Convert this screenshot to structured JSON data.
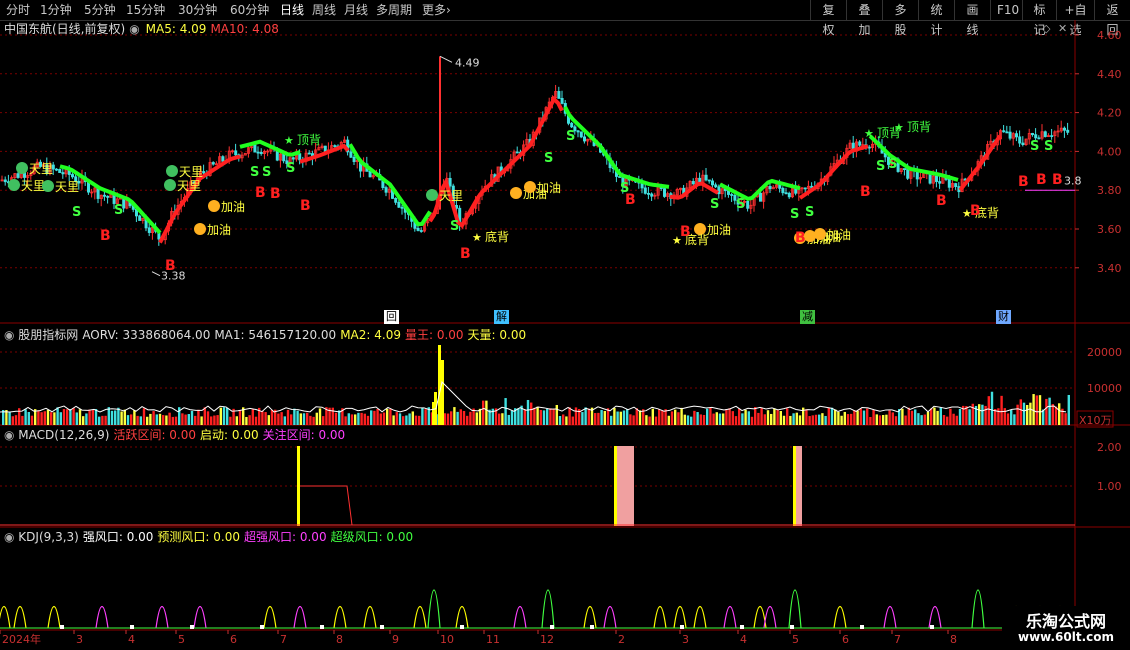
{
  "toolbar": {
    "periods": [
      "分时",
      "1分钟",
      "5分钟",
      "15分钟",
      "30分钟",
      "60分钟",
      "日线",
      "周线",
      "月线",
      "多周期",
      "更多"
    ],
    "active_period": "日线",
    "more_arrow": "›",
    "right_buttons": [
      "复权",
      "叠加",
      "多股",
      "统计",
      "画线",
      "F10",
      "标记",
      "+自选",
      "返回"
    ]
  },
  "main_panel": {
    "stock_name": "中国东航(日线,前复权)",
    "ma5_label": "MA5: 4.09",
    "ma10_label": "MA10: 4.08",
    "y_ticks": [
      "4.60",
      "4.40",
      "4.20",
      "4.00",
      "3.80",
      "3.60",
      "3.40"
    ],
    "high_label": "4.49",
    "low_label": "3.38",
    "right_value": "3.8",
    "annotations": [
      {
        "text": "天里",
        "type": "tianli",
        "color": "#ffff40"
      },
      {
        "text": "天里",
        "type": "tianli",
        "color": "#ffff40"
      },
      {
        "text": "天里",
        "type": "tianli",
        "color": "#ffff40"
      },
      {
        "text": "天里",
        "type": "tianli",
        "color": "#ffff40"
      },
      {
        "text": "天里",
        "type": "tianli",
        "color": "#ffff40"
      },
      {
        "text": "天里",
        "type": "tianli",
        "color": "#ffff40"
      },
      {
        "text": "加油",
        "type": "jiayou",
        "color": "#ffff40"
      },
      {
        "text": "加油",
        "type": "jiayou",
        "color": "#ffff40"
      },
      {
        "text": "加油",
        "type": "jiayou",
        "color": "#ffff40"
      },
      {
        "text": "加油",
        "type": "jiayou",
        "color": "#ffff40"
      },
      {
        "text": "加油",
        "type": "jiayou",
        "color": "#ffff40"
      },
      {
        "text": "加油",
        "type": "jiayou",
        "color": "#ffff40"
      },
      {
        "text": "加油",
        "type": "jiayou",
        "color": "#ffff40"
      },
      {
        "text": "加油",
        "type": "jiayou",
        "color": "#ffff40"
      },
      {
        "text": "顶背",
        "type": "dingbei",
        "color": "#40ff40"
      },
      {
        "text": "顶背",
        "type": "dingbei",
        "color": "#40ff40"
      },
      {
        "text": "顶背",
        "type": "dingbei",
        "color": "#40ff40"
      },
      {
        "text": "底背",
        "type": "dibei",
        "color": "#ffff40"
      },
      {
        "text": "底背",
        "type": "dibei",
        "color": "#ffff40"
      },
      {
        "text": "底背",
        "type": "dibei",
        "color": "#ffff40"
      }
    ],
    "event_labels": [
      {
        "text": "回",
        "bg": "#ffffff",
        "fg": "#000000"
      },
      {
        "text": "解",
        "bg": "#40c0ff",
        "fg": "#000000"
      },
      {
        "text": "减",
        "bg": "#40c040",
        "fg": "#000000"
      },
      {
        "text": "财",
        "bg": "#6fa8ff",
        "fg": "#000000"
      }
    ]
  },
  "volume_panel": {
    "indicator": "股朋指标网",
    "aorv": "AORV: 333868064.00",
    "ma1": "MA1: 546157120.00",
    "ma2": "MA2: 4.09",
    "liangwang": "量王: 0.00",
    "tianliang": "天量: 0.00",
    "y_ticks": [
      "20000",
      "10000"
    ],
    "unit": "X10万"
  },
  "macd_panel": {
    "name": "MACD(12,26,9)",
    "active": "活跃区间: 0.00",
    "start": "启动: 0.00",
    "focus": "关注区间: 0.00",
    "y_ticks": [
      "2.00",
      "1.00"
    ]
  },
  "kdj_panel": {
    "name": "KDJ(9,3,3)",
    "strong": "强风口: 0.00",
    "predict": "预测风口: 0.00",
    "super_strong": "超强风口: 0.00",
    "super": "超级风口: 0.00"
  },
  "x_axis": {
    "labels": [
      "2024年",
      "3",
      "4",
      "5",
      "6",
      "7",
      "8",
      "9",
      "10",
      "11",
      "12",
      "2",
      "3",
      "4",
      "5",
      "6",
      "7",
      "8"
    ]
  },
  "watermark": {
    "line1": "乐淘公式网",
    "line2": "www.60lt.com"
  },
  "colors": {
    "up": "#ff3030",
    "down": "#40e0e0",
    "ma_green": "#20ff20",
    "ma_red": "#ff2020",
    "grid": "#8b0000",
    "yellow": "#ffff00",
    "magenta": "#ff40ff",
    "pink": "#f0a0a0"
  }
}
